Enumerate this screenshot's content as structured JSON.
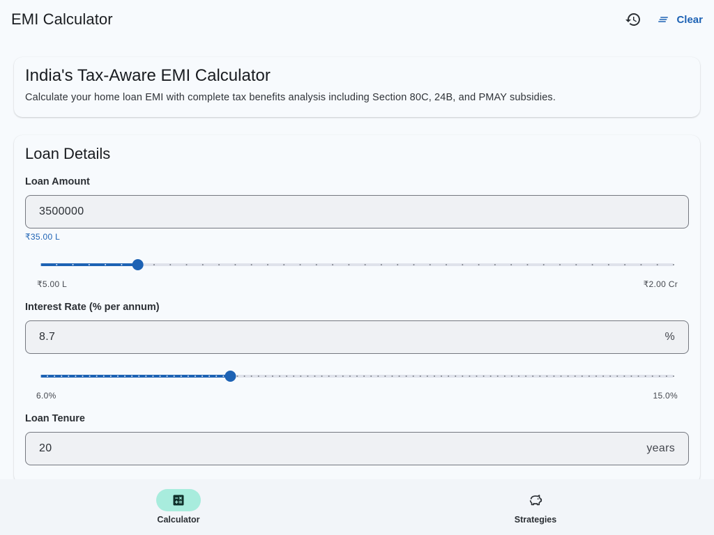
{
  "app_bar": {
    "title": "EMI Calculator",
    "history_icon": "history-icon",
    "clear_label": "Clear",
    "clear_icon": "clear-all-icon"
  },
  "intro": {
    "title": "India's Tax-Aware EMI Calculator",
    "description": "Calculate your home loan EMI with complete tax benefits analysis including Section 80C, 24B, and PMAY subsidies."
  },
  "loan_details": {
    "title": "Loan Details",
    "loan_amount": {
      "label": "Loan Amount",
      "value": "3500000",
      "helper": "₹35.00 L",
      "min_label": "₹5.00 L",
      "max_label": "₹2.00 Cr",
      "slider_fraction": 0.1538
    },
    "interest_rate": {
      "label": "Interest Rate (% per annum)",
      "value": "8.7",
      "suffix": "%",
      "min_label": "6.0%",
      "max_label": "15.0%",
      "slider_fraction": 0.3
    },
    "loan_tenure": {
      "label": "Loan Tenure",
      "value": "20",
      "suffix": "years"
    }
  },
  "bottom_nav": {
    "items": [
      {
        "label": "Calculator",
        "icon": "calculator-icon",
        "active": true
      },
      {
        "label": "Strategies",
        "icon": "piggy-bank-icon",
        "active": false
      }
    ]
  },
  "colors": {
    "accent": "#1d62b4",
    "active_pill": "#a8ecdd",
    "slider_track_inactive": "#dfe2eb"
  }
}
